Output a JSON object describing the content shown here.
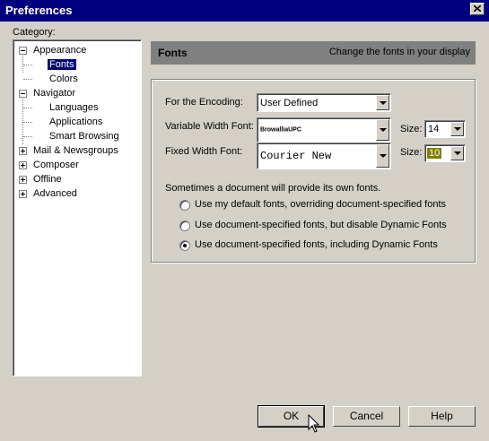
{
  "window": {
    "title": "Preferences"
  },
  "category_label": "Category:",
  "tree": [
    {
      "label": "Appearance",
      "expander": "minus"
    },
    {
      "label": "Fonts",
      "selected": true
    },
    {
      "label": "Colors"
    },
    {
      "label": "Navigator",
      "expander": "minus"
    },
    {
      "label": "Languages"
    },
    {
      "label": "Applications"
    },
    {
      "label": "Smart Browsing"
    },
    {
      "label": "Mail & Newsgroups",
      "expander": "plus"
    },
    {
      "label": "Composer",
      "expander": "plus"
    },
    {
      "label": "Offline",
      "expander": "plus"
    },
    {
      "label": "Advanced",
      "expander": "plus"
    }
  ],
  "header": {
    "title": "Fonts",
    "description": "Change the fonts in your display"
  },
  "encoding": {
    "label": "For the Encoding:",
    "value": "User Defined"
  },
  "variable_font": {
    "label": "Variable Width Font:",
    "value": "BrowalliaUPC",
    "size_label": "Size:",
    "size_value": "14"
  },
  "fixed_font": {
    "label": "Fixed Width Font:",
    "value": "Courier New",
    "size_label": "Size:",
    "size_value": "10"
  },
  "doc_fonts_text": "Sometimes a document will provide its own fonts.",
  "radio_options": [
    {
      "label": "Use my default fonts, overriding document-specified fonts",
      "checked": false
    },
    {
      "label": "Use document-specified fonts, but disable Dynamic Fonts",
      "checked": false
    },
    {
      "label": "Use document-specified fonts, including Dynamic Fonts",
      "checked": true
    }
  ],
  "buttons": {
    "ok": "OK",
    "cancel": "Cancel",
    "help": "Help"
  },
  "icons": {
    "close": "close-icon",
    "cursor": "mouse-cursor-icon"
  }
}
